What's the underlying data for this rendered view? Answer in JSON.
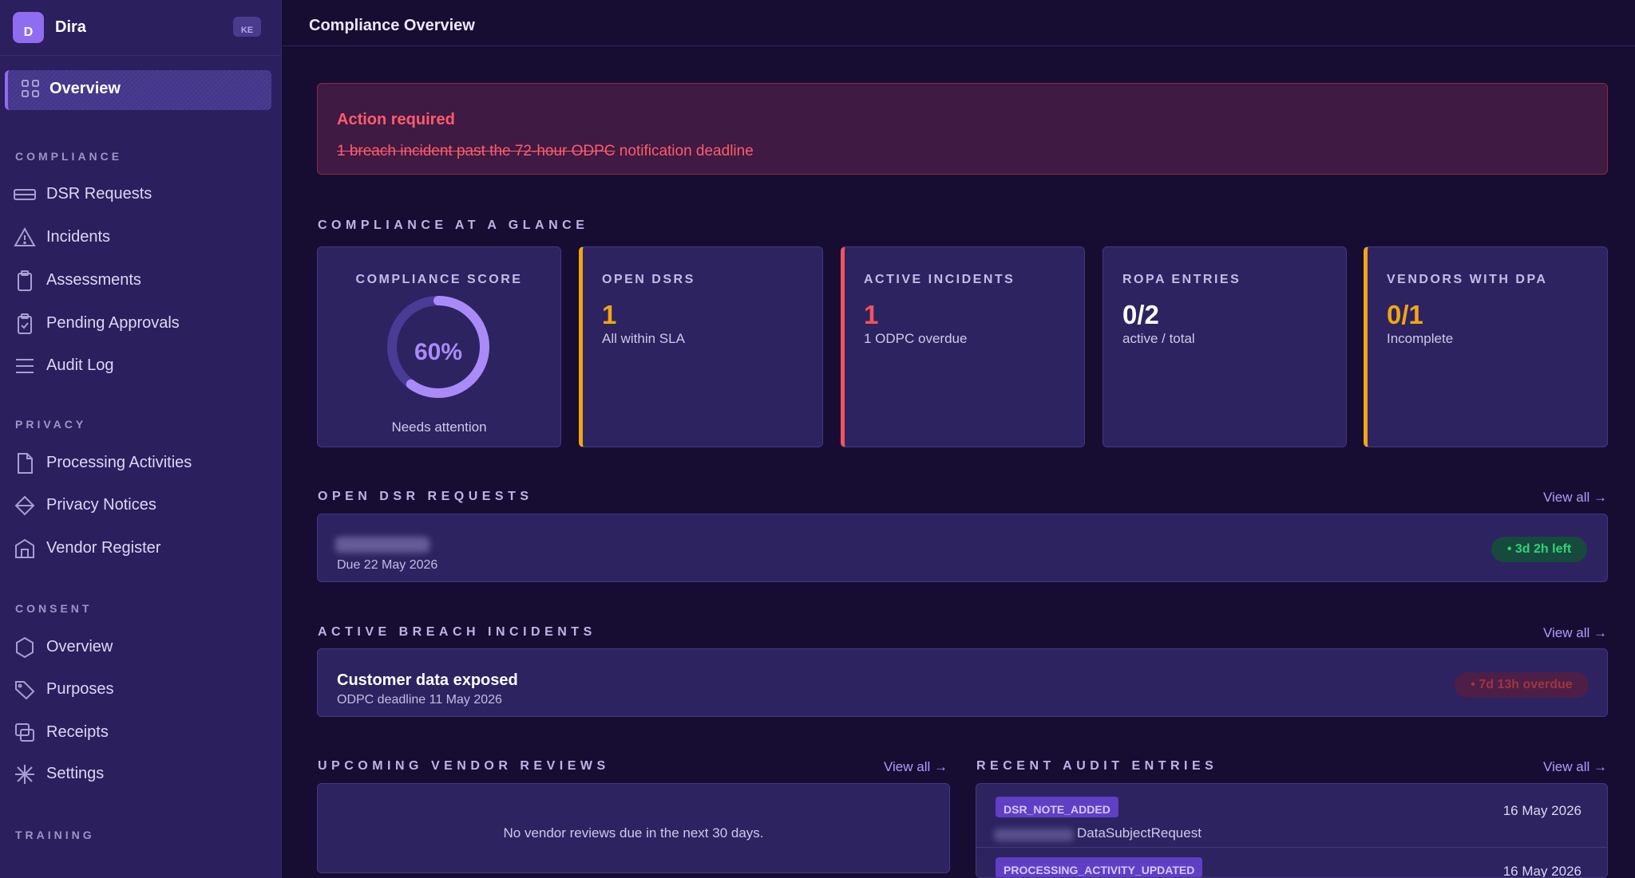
{
  "sidebar": {
    "brand_initial": "D",
    "brand_name": "Dira",
    "region_badge": "KE",
    "active_item": "Overview",
    "sections": {
      "compliance": "COMPLIANCE",
      "privacy": "PRIVACY",
      "consent": "CONSENT",
      "training": "TRAINING"
    },
    "compliance_items": [
      "DSR Requests",
      "Incidents",
      "Assessments",
      "Pending Approvals",
      "Audit Log"
    ],
    "privacy_items": [
      "Processing Activities",
      "Privacy Notices",
      "Vendor Register"
    ],
    "consent_items": [
      "Overview",
      "Purposes",
      "Receipts",
      "Settings"
    ]
  },
  "header": {
    "title": "Compliance Overview"
  },
  "alert": {
    "title": "Action required",
    "message_struck": "1 breach incident past the 72-hour ODPC",
    "message_rest": " notification deadline"
  },
  "glance": {
    "heading": "COMPLIANCE AT A GLANCE",
    "score": {
      "label": "COMPLIANCE SCORE",
      "value": "60%",
      "percent": 60,
      "status": "Needs attention"
    },
    "cards": [
      {
        "label": "OPEN DSRS",
        "value": "1",
        "sub": "All within SLA",
        "accent": "#f2a515"
      },
      {
        "label": "ACTIVE INCIDENTS",
        "value": "1",
        "sub": "1 ODPC overdue",
        "accent": "#f2535f"
      },
      {
        "label": "ROPA ENTRIES",
        "value": "0/2",
        "sub": "active / total",
        "accent": "#ffffff"
      },
      {
        "label": "VENDORS WITH DPA",
        "value": "0/1",
        "sub": "Incomplete",
        "accent": "#f2a515"
      }
    ]
  },
  "dsr": {
    "heading": "OPEN DSR REQUESTS",
    "view_all": "View all →",
    "item": {
      "due": "Due 22 May 2026",
      "badge": "• 3d 2h left"
    }
  },
  "breach": {
    "heading": "ACTIVE BREACH INCIDENTS",
    "view_all": "View all →",
    "item": {
      "title": "Customer data exposed",
      "sub": "ODPC deadline 11 May 2026",
      "badge": "• 7d 13h overdue"
    }
  },
  "vendor_reviews": {
    "heading": "UPCOMING VENDOR REVIEWS",
    "view_all": "View all →",
    "empty": "No vendor reviews due in the next 30 days."
  },
  "audit": {
    "heading": "RECENT AUDIT ENTRIES",
    "view_all": "View all →",
    "entries": [
      {
        "tag": "DSR_NOTE_ADDED",
        "entity": "DataSubjectRequest",
        "date": "16 May 2026"
      },
      {
        "tag": "PROCESSING_ACTIVITY_UPDATED",
        "entity": "",
        "date": "16 May 2026"
      }
    ]
  },
  "colors": {
    "accent": "#8f6cf0",
    "warning": "#f2a515",
    "danger": "#f2535f",
    "success": "#2ed27a"
  }
}
